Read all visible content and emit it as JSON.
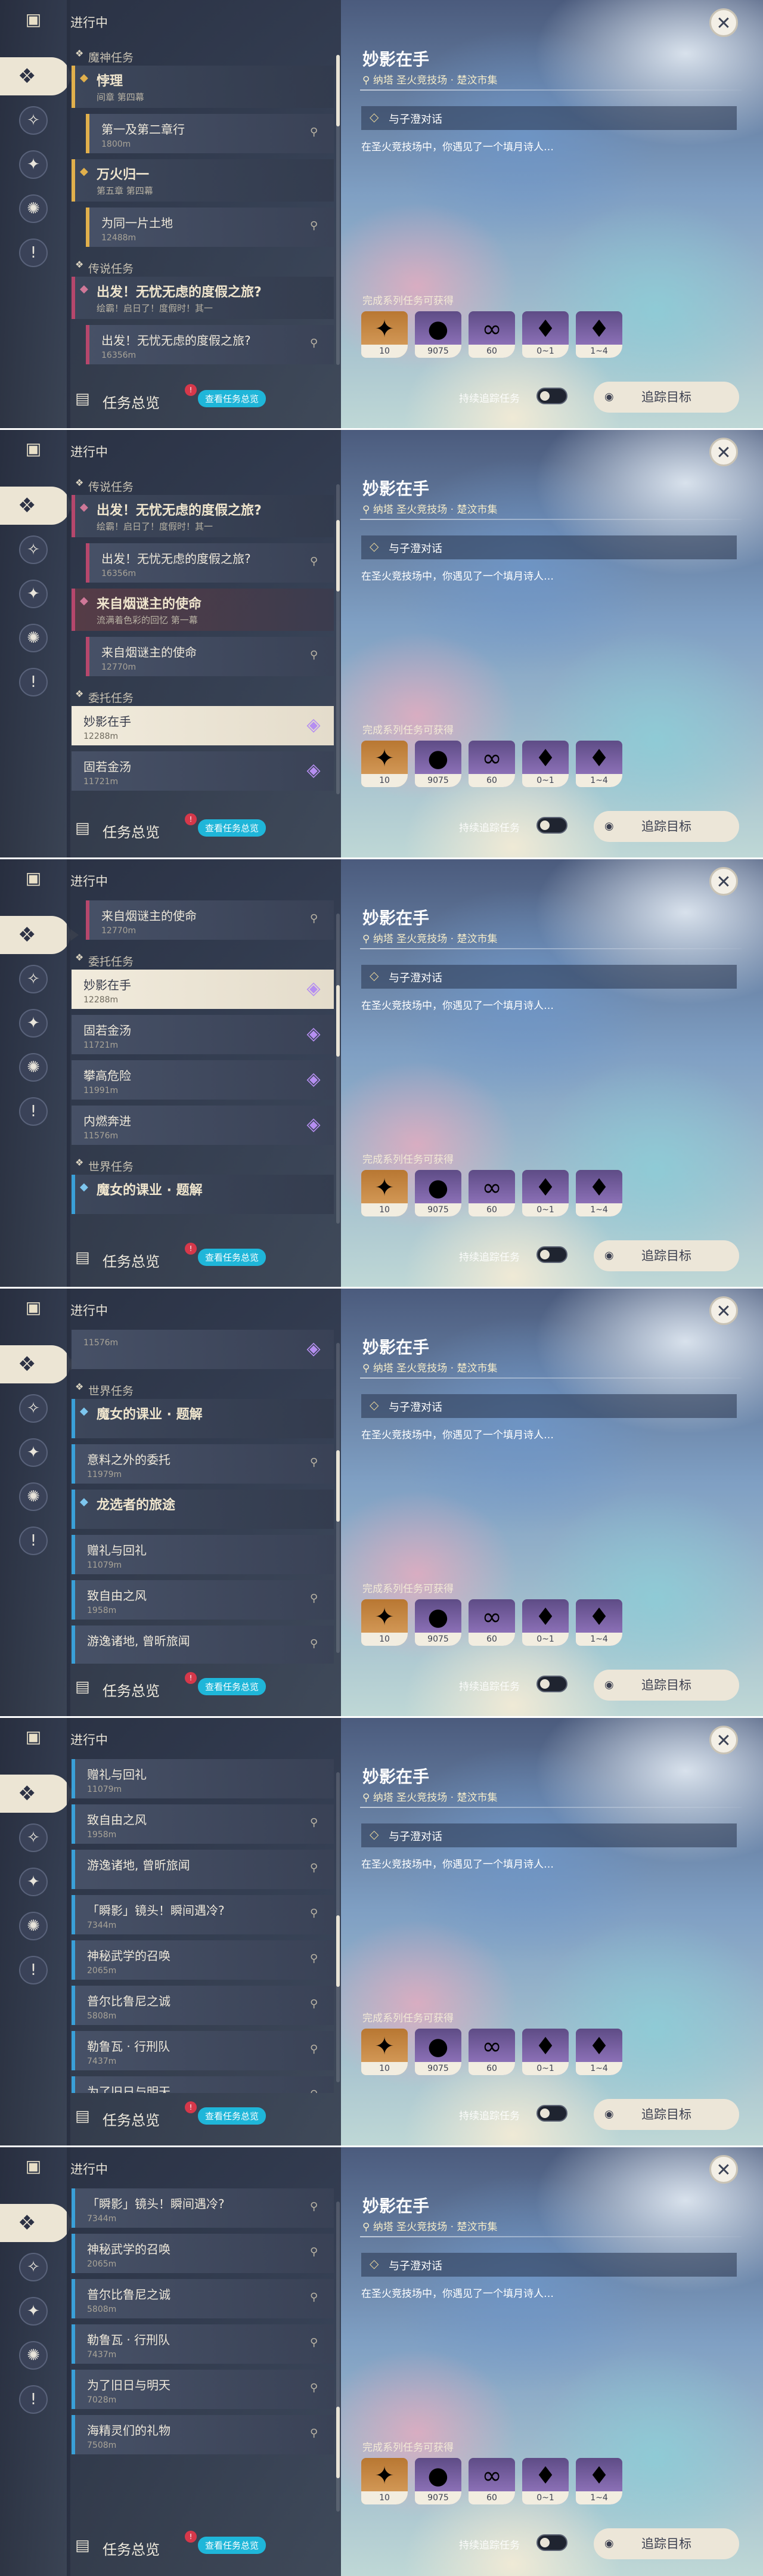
{
  "panel_title": "进行中",
  "detail": {
    "title": "妙影在手",
    "location": "纳塔 圣火竞技场 · 楚汶市集",
    "step": "与子澄对话",
    "description": "在圣火竞技场中，你遇见了一个填月诗人…",
    "rewards_label": "完成系列任务可获得",
    "rewards": [
      {
        "name": "adventure-exp",
        "count": "10",
        "style": "gold",
        "glyph": "✦"
      },
      {
        "name": "mora",
        "count": "9075",
        "style": "purple",
        "glyph": "●"
      },
      {
        "name": "companionship-exp",
        "count": "60",
        "style": "purple",
        "glyph": "∞"
      },
      {
        "name": "gem-green",
        "count": "0~1",
        "style": "purple",
        "glyph": "♦"
      },
      {
        "name": "gem-pink",
        "count": "1~4",
        "style": "purple",
        "glyph": "♦"
      }
    ],
    "track_toggle_label": "持续追踪任务",
    "track_button": "追踪目标"
  },
  "footer": {
    "label": "任务总览",
    "button": "查看任务总览",
    "badge": "!"
  },
  "screens": [
    {
      "scroll": 0.0,
      "rows": [
        {
          "kind": "cat",
          "text": "魔神任务"
        },
        {
          "kind": "chain",
          "style": "",
          "title": "悖理",
          "sub": "间章 第四幕"
        },
        {
          "kind": "item",
          "style": "",
          "title": "第一及第二章行",
          "dist": "1800m",
          "side": "pin"
        },
        {
          "kind": "chain",
          "style": "",
          "title": "万火归一",
          "sub": "第五章 第四幕"
        },
        {
          "kind": "item",
          "style": "",
          "title": "为同一片土地",
          "dist": "12488m",
          "side": "pin"
        },
        {
          "kind": "cat",
          "text": "传说任务"
        },
        {
          "kind": "chain",
          "style": "legend",
          "title": "出发！无忧无虑的度假之旅?",
          "sub": "绘霸！启日了！度假时！其一"
        },
        {
          "kind": "item",
          "style": "legend",
          "title": "出发！无忧无虑的度假之旅?",
          "dist": "16356m",
          "side": "pin"
        }
      ]
    },
    {
      "scroll": 0.15,
      "rows": [
        {
          "kind": "cat",
          "text": "传说任务"
        },
        {
          "kind": "chain",
          "style": "legend",
          "title": "出发！无忧无虑的度假之旅?",
          "sub": "绘霸！启日了！度假时！其一"
        },
        {
          "kind": "item",
          "style": "legend",
          "title": "出发！无忧无虑的度假之旅?",
          "dist": "16356m",
          "side": "pin"
        },
        {
          "kind": "chain",
          "style": "legend chosen",
          "title": "来自烟谜主的使命",
          "sub": "流满着色彩的回忆 第一幕"
        },
        {
          "kind": "item",
          "style": "legend",
          "title": "来自烟谜主的使命",
          "dist": "12770m",
          "side": "pin"
        },
        {
          "kind": "cat",
          "text": "委托任务"
        },
        {
          "kind": "item",
          "style": "commission selected",
          "title": "妙影在手",
          "dist": "12288m",
          "side": "gem"
        },
        {
          "kind": "item",
          "style": "commission",
          "title": "固若金汤",
          "dist": "11721m",
          "side": "gem"
        }
      ]
    },
    {
      "scroll": 0.3,
      "rows": [
        {
          "kind": "item",
          "style": "legend",
          "title": "来自烟谜主的使命",
          "dist": "12770m",
          "side": "pin"
        },
        {
          "kind": "cat",
          "text": "委托任务"
        },
        {
          "kind": "item",
          "style": "commission selected",
          "title": "妙影在手",
          "dist": "12288m",
          "side": "gem"
        },
        {
          "kind": "item",
          "style": "commission",
          "title": "固若金汤",
          "dist": "11721m",
          "side": "gem"
        },
        {
          "kind": "item",
          "style": "commission",
          "title": "攀高危险",
          "dist": "11991m",
          "side": "gem"
        },
        {
          "kind": "item",
          "style": "commission",
          "title": "内燃奔进",
          "dist": "11576m",
          "side": "gem"
        },
        {
          "kind": "cat",
          "text": "世界任务"
        },
        {
          "kind": "chain",
          "style": "world",
          "title": "魔女的课业 · 题解",
          "sub": ""
        }
      ]
    },
    {
      "scroll": 0.45,
      "rows": [
        {
          "kind": "item",
          "style": "commission",
          "title": "",
          "dist": "11576m",
          "side": "gem"
        },
        {
          "kind": "cat",
          "text": "世界任务"
        },
        {
          "kind": "chain",
          "style": "world",
          "title": "魔女的课业 · 题解",
          "sub": ""
        },
        {
          "kind": "item",
          "style": "world",
          "title": "意料之外的委托",
          "dist": "11979m",
          "side": "pin"
        },
        {
          "kind": "chain",
          "style": "world",
          "title": "龙选者的旅途",
          "sub": ""
        },
        {
          "kind": "item",
          "style": "world",
          "title": "赠礼与回礼",
          "dist": "11079m",
          "side": "none"
        },
        {
          "kind": "item",
          "style": "world",
          "title": "致自由之风",
          "dist": "1958m",
          "side": "pin"
        },
        {
          "kind": "item",
          "style": "world",
          "title": "游逸诸地, 曾昕旅闻",
          "dist": "",
          "side": "pin"
        }
      ]
    },
    {
      "scroll": 0.6,
      "rows": [
        {
          "kind": "item",
          "style": "world",
          "title": "赠礼与回礼",
          "dist": "11079m",
          "side": "none"
        },
        {
          "kind": "item",
          "style": "world",
          "title": "致自由之风",
          "dist": "1958m",
          "side": "pin"
        },
        {
          "kind": "item",
          "style": "world",
          "title": "游逸诸地, 曾昕旅闻",
          "dist": "",
          "side": "pin"
        },
        {
          "kind": "item",
          "style": "world",
          "title": "「瞬影」镜头！瞬间遇冷?",
          "dist": "7344m",
          "side": "pin"
        },
        {
          "kind": "item",
          "style": "world",
          "title": "神秘武学的召唤",
          "dist": "2065m",
          "side": "pin"
        },
        {
          "kind": "item",
          "style": "world",
          "title": "普尔比鲁尼之诚",
          "dist": "5808m",
          "side": "pin"
        },
        {
          "kind": "item",
          "style": "world",
          "title": "勒鲁瓦 · 行刑队",
          "dist": "7437m",
          "side": "pin"
        },
        {
          "kind": "item",
          "style": "world",
          "title": "为了旧日与明天",
          "dist": "",
          "side": "pin"
        }
      ]
    },
    {
      "scroll": 0.86,
      "rows": [
        {
          "kind": "item",
          "style": "world",
          "title": "「瞬影」镜头！瞬间遇冷?",
          "dist": "7344m",
          "side": "pin"
        },
        {
          "kind": "item",
          "style": "world",
          "title": "神秘武学的召唤",
          "dist": "2065m",
          "side": "pin"
        },
        {
          "kind": "item",
          "style": "world",
          "title": "普尔比鲁尼之诚",
          "dist": "5808m",
          "side": "pin"
        },
        {
          "kind": "item",
          "style": "world",
          "title": "勒鲁瓦 · 行刑队",
          "dist": "7437m",
          "side": "pin"
        },
        {
          "kind": "item",
          "style": "world",
          "title": "为了旧日与明天",
          "dist": "7028m",
          "side": "pin"
        },
        {
          "kind": "item",
          "style": "world",
          "title": "海精灵们的礼物",
          "dist": "7508m",
          "side": "pin"
        }
      ]
    }
  ]
}
